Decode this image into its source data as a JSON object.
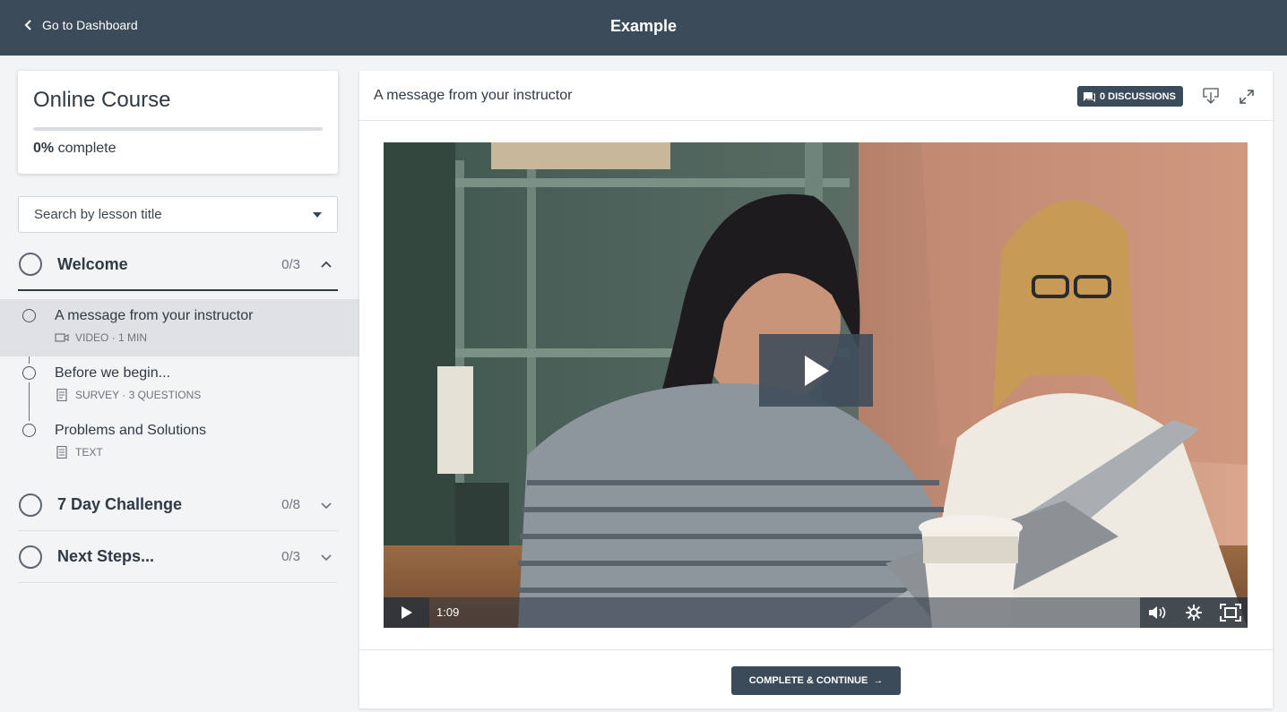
{
  "topbar": {
    "back_label": "Go to Dashboard",
    "title": "Example"
  },
  "sidebar": {
    "course_name": "Online Course",
    "progress_pct": "0%",
    "progress_word": "complete",
    "progress_fraction": 0,
    "search_placeholder": "Search by lesson title",
    "chapters": [
      {
        "title": "Welcome",
        "count": "0/3",
        "expanded": true,
        "lessons": [
          {
            "title": "A message from your instructor",
            "meta": "VIDEO · 1 MIN",
            "icon": "video-icon",
            "active": true
          },
          {
            "title": "Before we begin...",
            "meta": "SURVEY · 3 QUESTIONS",
            "icon": "survey-icon",
            "active": false
          },
          {
            "title": "Problems and Solutions",
            "meta": "TEXT",
            "icon": "text-icon",
            "active": false
          }
        ]
      },
      {
        "title": "7 Day Challenge",
        "count": "0/8",
        "expanded": false
      },
      {
        "title": "Next Steps...",
        "count": "0/3",
        "expanded": false
      }
    ]
  },
  "main": {
    "lesson_title": "A message from your instructor",
    "discussions_label": "0 DISCUSSIONS",
    "video": {
      "time": "1:09"
    },
    "complete_label": "COMPLETE & CONTINUE",
    "complete_arrow": "→"
  },
  "colors": {
    "header": "#3c4b5a",
    "active_row": "#dfe1e4",
    "background": "#f3f4f6"
  }
}
